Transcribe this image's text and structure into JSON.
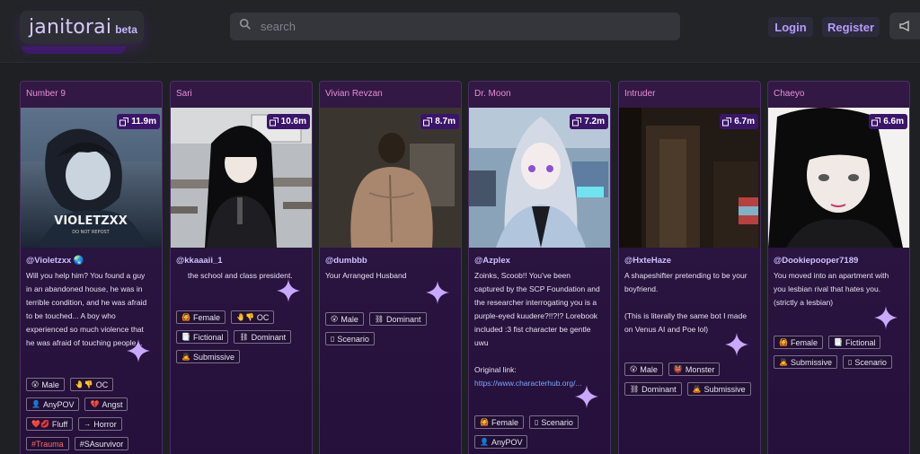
{
  "header": {
    "logo_main": "janitorai",
    "logo_beta": "beta",
    "search_placeholder": "search",
    "login_label": "Login",
    "register_label": "Register"
  },
  "cards": [
    {
      "title": "Number 9",
      "views": "11.9m",
      "creator": "@Violetzxx 🌏",
      "description_lines": [
        "Will you help him? You found a guy",
        "in an abandoned house, he was in",
        "terrible condition, and he was afraid",
        "to be touched... A boy who",
        "experienced so much violence that",
        "he was afraid of touching people..."
      ],
      "image_caption": "VIOLETZXX",
      "image_caption_sub": "DO NOT REPOST",
      "tags": [
        {
          "icon": "😮",
          "label": "Male"
        },
        {
          "icon": "🤚👎",
          "label": "OC"
        },
        {
          "icon": "👤",
          "label": "AnyPOV"
        },
        {
          "icon": "💔",
          "label": "Angst"
        },
        {
          "icon": "❤️💋",
          "label": "Fluff"
        },
        {
          "icon": "→",
          "label": "Horror"
        },
        {
          "icon": "",
          "label": "#Trauma",
          "red": true
        },
        {
          "icon": "",
          "label": "#SAsurvivor"
        }
      ]
    },
    {
      "title": "Sari",
      "views": "10.6m",
      "creator": "@kkaaaii_1",
      "description_lines": [
        "the school and class president."
      ],
      "tags": [
        {
          "icon": "🙆",
          "label": "Female"
        },
        {
          "icon": "🤚👎",
          "label": "OC"
        },
        {
          "icon": "📑",
          "label": "Fictional"
        },
        {
          "icon": "⛓",
          "label": "Dominant"
        },
        {
          "icon": "🙇",
          "label": "Submissive"
        }
      ]
    },
    {
      "title": "Vivian Revzan",
      "views": "8.7m",
      "creator": "@dumbbb",
      "description_lines": [
        "Your Arranged Husband"
      ],
      "tags": [
        {
          "icon": "😮",
          "label": "Male"
        },
        {
          "icon": "⛓",
          "label": "Dominant"
        },
        {
          "icon": "▯",
          "label": "Scenario"
        }
      ]
    },
    {
      "title": "Dr. Moon",
      "views": "7.2m",
      "creator": "@Azplex",
      "description_lines": [
        "Zoinks, Scoob!! You've been",
        "captured by the SCP Foundation and",
        "the researcher interrogating you is a",
        "purple-eyed kuudere?!!?!? Lorebook",
        "included :3 fist character be gentle",
        "uwu",
        "",
        "Original link:",
        "https://www.characterhub.org/..."
      ],
      "tags": [
        {
          "icon": "🙆",
          "label": "Female"
        },
        {
          "icon": "▯",
          "label": "Scenario"
        },
        {
          "icon": "👤",
          "label": "AnyPOV"
        }
      ]
    },
    {
      "title": "Intruder",
      "views": "6.7m",
      "creator": "@HxteHaze",
      "description_lines": [
        "A shapeshifter pretending to be your",
        "boyfriend.",
        "",
        "(This is literally the same bot I made",
        "on Venus AI and Poe lol)"
      ],
      "tags": [
        {
          "icon": "😮",
          "label": "Male"
        },
        {
          "icon": "👹",
          "label": "Monster"
        },
        {
          "icon": "⛓",
          "label": "Dominant"
        },
        {
          "icon": "🙇",
          "label": "Submissive"
        }
      ]
    },
    {
      "title": "Chaeyo",
      "views": "6.6m",
      "creator": "@Dookiepooper7189",
      "description_lines": [
        "You moved into an apartment with",
        "you lesbian rival that hates you.",
        "(strictly a lesbian)"
      ],
      "tags": [
        {
          "icon": "🙆",
          "label": "Female"
        },
        {
          "icon": "📑",
          "label": "Fictional"
        },
        {
          "icon": "🙇",
          "label": "Submissive"
        },
        {
          "icon": "▯",
          "label": "Scenario"
        }
      ]
    }
  ]
}
